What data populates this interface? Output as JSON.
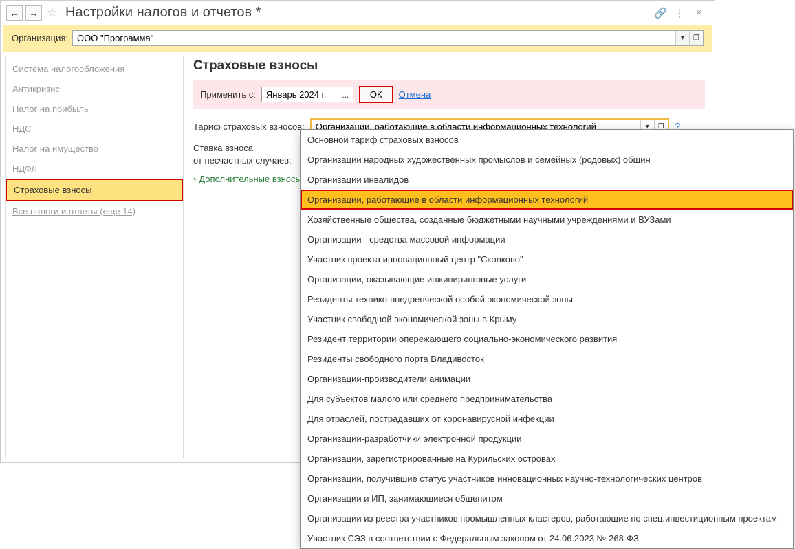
{
  "header": {
    "title": "Настройки налогов и отчетов *"
  },
  "org": {
    "label": "Организация:",
    "value": "ООО \"Программа\""
  },
  "sidebar": {
    "items": [
      "Система налогообложения",
      "Антикризис",
      "Налог на прибыль",
      "НДС",
      "Налог на имущество",
      "НДФЛ",
      "Страховые взносы"
    ],
    "link": "Все налоги и отчеты (еще 14)"
  },
  "content": {
    "title": "Страховые взносы",
    "apply_label": "Применить с:",
    "apply_value": "Январь 2024 г.",
    "ok": "ОК",
    "cancel": "Отмена",
    "tariff_label": "Тариф страховых взносов:",
    "tariff_value": "Организации, работающие в области информационных технологий",
    "rate_line1": "Ставка взноса",
    "rate_line2": "от несчастных случаев:",
    "extra": "Дополнительные взносы"
  },
  "dropdown": {
    "options": [
      "Основной тариф страховых взносов",
      "Организации народных художественных промыслов и семейных (родовых) общин",
      "Организации инвалидов",
      "Организации, работающие в области информационных технологий",
      "Хозяйственные общества, созданные бюджетными научными учреждениями и ВУЗами",
      "Организации - средства массовой информации",
      "Участник проекта инновационный центр \"Сколково\"",
      "Организации, оказывающие инжиниринговые услуги",
      "Резиденты технико-внедренческой особой экономической зоны",
      "Участник свободной экономической зоны в Крыму",
      "Резидент территории опережающего социально-экономического развития",
      "Резиденты свободного порта Владивосток",
      "Организации-производители анимации",
      "Для субъектов малого или среднего предпринимательства",
      "Для отраслей, пострадавших от коронавирусной инфекции",
      "Организации-разработчики электронной продукции",
      "Организации, зарегистрированные на Курильских островах",
      "Организации, получившие статус участников инновационных научно-технологических центров",
      "Организации и ИП, занимающиеся общепитом",
      "Организации из реестра участников промышленных кластеров, работающие по спец.инвестиционным проектам",
      "Участник СЭЗ в соответствии с Федеральным законом от 24.06.2023 № 268-ФЗ"
    ],
    "selected_index": 3
  }
}
